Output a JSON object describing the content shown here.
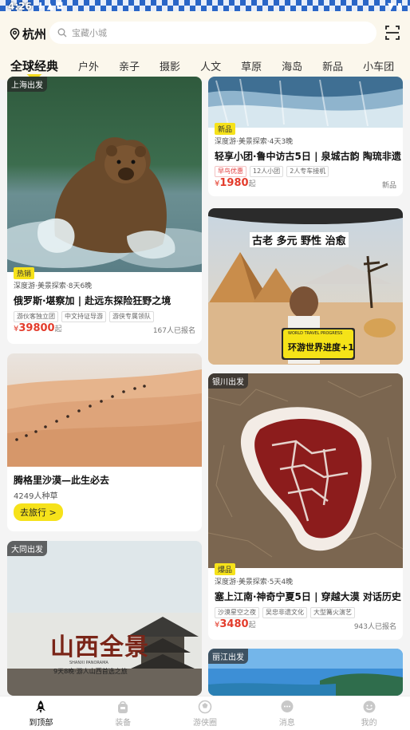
{
  "status_bar": {
    "time": "4:26",
    "icons_left": "⬇ ▲ ◘",
    "icons_right": "▼ ▮"
  },
  "header": {
    "city": "杭州",
    "search_placeholder": "宝藏小城"
  },
  "tabs": [
    {
      "label": "全球经典",
      "active": true
    },
    {
      "label": "户外"
    },
    {
      "label": "亲子"
    },
    {
      "label": "摄影"
    },
    {
      "label": "人文"
    },
    {
      "label": "草原"
    },
    {
      "label": "海岛"
    },
    {
      "label": "新品"
    },
    {
      "label": "小车团"
    }
  ],
  "cards": {
    "bear": {
      "origin": "上海出发",
      "badge": "热销",
      "category": "深度游·美景探索·8天6晚",
      "title": "俄罗斯·堪察加 | 赴远东探险狂野之境",
      "tags": [
        "游伙客独立团",
        "中文持证导游",
        "游侠专属领队"
      ],
      "currency": "¥",
      "price": "39800",
      "price_suffix": "起",
      "signups": "167人已报名"
    },
    "waterfall": {
      "badge": "新品",
      "category": "深度游·美景探索·4天3晚",
      "title": "轻享小团·鲁中访古5日 | 泉城古韵 陶琉非遗",
      "tags": [
        "早鸟优惠",
        "12人小团",
        "2人专车接机"
      ],
      "currency": "¥",
      "price": "1980",
      "price_suffix": "起",
      "note": "新品"
    },
    "egypt": {
      "overlay_words": "古老 多元 野性 治愈",
      "sign_text": "环游世界进度+1",
      "sign_small": "WORLD TRAVEL PROGRESS"
    },
    "desert": {
      "title": "腾格里沙漠—此生必去",
      "count": "4249人种草",
      "button": "去旅行 >"
    },
    "salt": {
      "origin": "银川出发",
      "badge": "爆品",
      "category": "深度游·美景探索·5天4晚",
      "title": "塞上江南·神奇宁夏5日 | 穿越大漠 对话历史",
      "tags": [
        "沙漠星空之夜",
        "吴忠非遗文化",
        "大型篝火演艺"
      ],
      "currency": "¥",
      "price": "3480",
      "price_suffix": "起",
      "signups": "943人已报名"
    },
    "shanxi": {
      "origin": "大同出发",
      "poster_title": "山西全景",
      "poster_sub": "9天8晚·游人山西首选之旅",
      "poster_small": "SHANXI PANORAMA"
    },
    "lijiang": {
      "origin": "丽江出发"
    }
  },
  "nav": [
    {
      "label": "到顶部",
      "icon": "rocket-icon",
      "active": true
    },
    {
      "label": "装备",
      "icon": "backpack-icon"
    },
    {
      "label": "游侠圈",
      "icon": "ball-icon"
    },
    {
      "label": "消息",
      "icon": "chat-icon"
    },
    {
      "label": "我的",
      "icon": "smile-icon"
    }
  ],
  "colors": {
    "accent": "#f6e21a",
    "price": "#e33c2c",
    "header_bg": "#fbf7ec"
  }
}
